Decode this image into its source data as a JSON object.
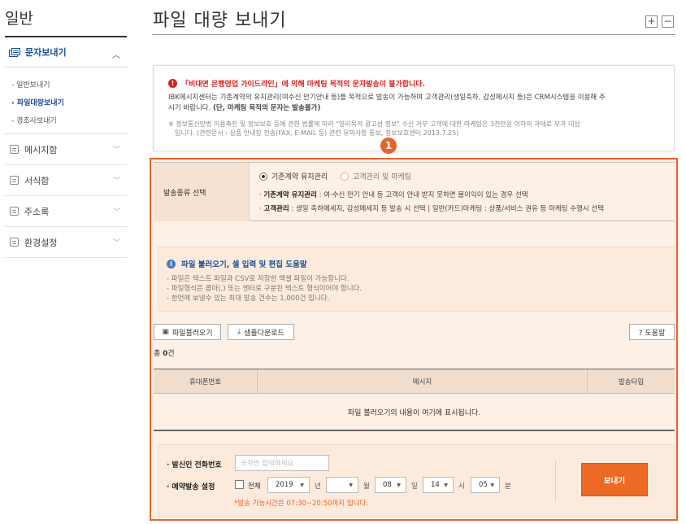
{
  "sidebar": {
    "title": "일반",
    "active_menu": "문자보내기",
    "sub_items": [
      "일반보내기",
      "파일대량보내기",
      "경조사보내기"
    ],
    "items": [
      "메시지함",
      "서식함",
      "주소록",
      "환경설정"
    ]
  },
  "header": {
    "title": "파일 대량 보내기",
    "zoom_in": "+",
    "zoom_out": "−"
  },
  "notice": {
    "warning": "「비대면 은행영업 가이드라인」에 의해 마케팅 목적의 문자발송이 불가합니다.",
    "line1": "IBK메시지센터는 기존계약의 유지관리(여수신 만기안내 등)를 목적으로 발송이 가능하며 고객관리(생일축하, 감성메시지 등)은 CRM시스템을 이용해 주",
    "line2a": "시기 바랍니다. ",
    "line2b": "(단, 마케팅 목적의 문자는 발송불가)",
    "small1": "※ 정보통신망법 이용촉진 및 정보보호 등에 관한 법률에 따라 \"영리목적 광고성 정보\" 수신 거부 고객에 대한 마케팅은 3천만원 이하의 과태료 부과 대상",
    "small2": "입니다. (관련문서 : 상품 안내장 전송(FAX, E-MAIL 등) 관련 유의사항 통보, 정보보호센터 2013.7.25)"
  },
  "badge": "1",
  "send_type": {
    "label": "발송종류 선택",
    "option1": "기존계약 유지관리",
    "option2": "고객관리 및 마케팅",
    "desc1_b": "기존계약 유지관리",
    "desc1": " : 여·수신 만기 안내 등 고객이 안내 받지 못하면 불이익이 있는 경우 선택",
    "desc2_b": "고객관리",
    "desc2": " : 생일 축하메세지, 감성메세지 등 발송 시 선택 | 일반(카드)마케팅 : 상품/서비스 권유 등 마케팅 수행시 선택"
  },
  "help": {
    "title": "파일 불러오기, 셀 입력 및 편집 도움말",
    "items": [
      "- 파일은 텍스트 파일과 CSV로 저장한 엑셀 파일이 가능합니다.",
      "- 파일형식은 콤마(,) 또는 엔터로 구분된 텍스트 형식이어야 합니다.",
      "- 한번에 보낼수 있는 최대 발송 건수는 1,000건 입니다."
    ]
  },
  "toolbar": {
    "load_file": "파일불러오기",
    "sample_download": "샘플다운로드",
    "help": "? 도움말"
  },
  "count": {
    "prefix": "총 ",
    "value": "0",
    "suffix": "건"
  },
  "grid": {
    "columns": [
      "휴대폰번호",
      "메시지",
      "발송타입"
    ],
    "empty_text": "파일 불러오기의 내용이 여기에 표시됩니다."
  },
  "send": {
    "sender_label": "· 발신인 전화번호",
    "sender_placeholder": "숫자만 입력하세요",
    "reserve_label": "· 예약발송 설정",
    "all_label": "전체",
    "year": "2019",
    "year_unit": "년",
    "month": "",
    "month_unit": "월",
    "day": "08",
    "day_unit": "일",
    "hour": "14",
    "hour_unit": "시",
    "minute": "05",
    "minute_unit": "분",
    "note": "*발송 가능시간은 07:30~20:50까지 입니다.",
    "send_button": "보내기"
  }
}
